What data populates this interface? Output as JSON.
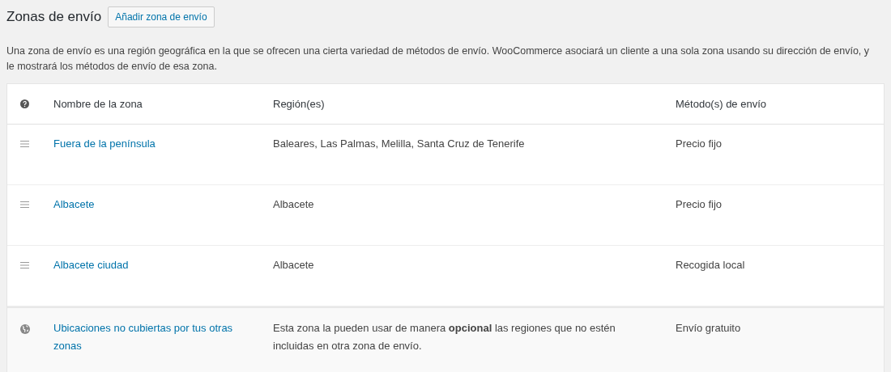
{
  "title": "Zonas de envío",
  "add_button": "Añadir zona de envío",
  "description": "Una zona de envío es una región geográfica en la que se ofrecen una cierta variedad de métodos de envío. WooCommerce asociará un cliente a una sola zona usando su dirección de envío, y le mostrará los métodos de envío de esa zona.",
  "table": {
    "columns": [
      "Nombre de la zona",
      "Región(es)",
      "Método(s) de envío"
    ],
    "rows": [
      {
        "kind": "zone",
        "name": "Fuera de la península",
        "regions": "Baleares, Las Palmas, Melilla, Santa Cruz de Tenerife",
        "methods": "Precio fijo"
      },
      {
        "kind": "zone",
        "name": "Albacete",
        "regions": "Albacete",
        "methods": "Precio fijo"
      },
      {
        "kind": "zone",
        "name": "Albacete ciudad",
        "regions": "Albacete",
        "methods": "Recogida local"
      },
      {
        "kind": "fallback",
        "name": "Ubicaciones no cubiertas por tus otras zonas",
        "regions": "Esta zona la pueden usar de manera **opcional** las regiones que no estén incluidas en otra zona de envío.",
        "methods": "Envío gratuito"
      }
    ]
  }
}
